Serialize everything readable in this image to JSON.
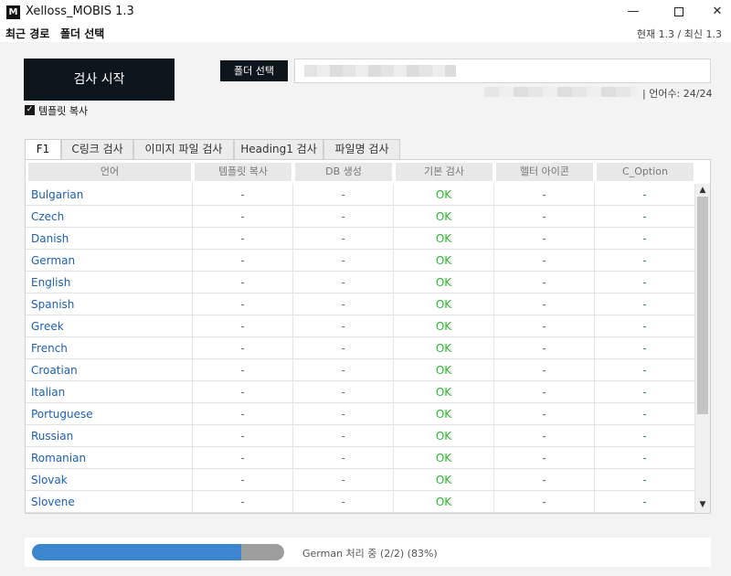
{
  "window": {
    "logo_letter": "M",
    "title": "Xelloss_MOBIS 1.3"
  },
  "menu": {
    "recent": "최근 경로",
    "folder": "폴더 선택",
    "version": "현재 1.3 / 최신 1.3"
  },
  "controls": {
    "start_label": "검사 시작",
    "template_copy_label": "템플릿 복사",
    "template_copy_checked": true,
    "folder_button": "폴더 선택",
    "lang_count": "|  언어수: 24/24"
  },
  "tabs": [
    "F1",
    "C링크 검사",
    "이미지 파일 검사",
    "Heading1 검사",
    "파일명 검사"
  ],
  "table": {
    "headers": [
      "언어",
      "템플릿 복사",
      "DB 생성",
      "기본 검사",
      "헬터 아이콘",
      "C_Option"
    ],
    "rows": [
      [
        "Bulgarian",
        "-",
        "-",
        "OK",
        "-",
        "-"
      ],
      [
        "Czech",
        "-",
        "-",
        "OK",
        "-",
        "-"
      ],
      [
        "Danish",
        "-",
        "-",
        "OK",
        "-",
        "-"
      ],
      [
        "German",
        "-",
        "-",
        "OK",
        "-",
        "-"
      ],
      [
        "English",
        "-",
        "-",
        "OK",
        "-",
        "-"
      ],
      [
        "Spanish",
        "-",
        "-",
        "OK",
        "-",
        "-"
      ],
      [
        "Greek",
        "-",
        "-",
        "OK",
        "-",
        "-"
      ],
      [
        "French",
        "-",
        "-",
        "OK",
        "-",
        "-"
      ],
      [
        "Croatian",
        "-",
        "-",
        "OK",
        "-",
        "-"
      ],
      [
        "Italian",
        "-",
        "-",
        "OK",
        "-",
        "-"
      ],
      [
        "Portuguese",
        "-",
        "-",
        "OK",
        "-",
        "-"
      ],
      [
        "Russian",
        "-",
        "-",
        "OK",
        "-",
        "-"
      ],
      [
        "Romanian",
        "-",
        "-",
        "OK",
        "-",
        "-"
      ],
      [
        "Slovak",
        "-",
        "-",
        "OK",
        "-",
        "-"
      ],
      [
        "Slovene",
        "-",
        "-",
        "OK",
        "-",
        "-"
      ]
    ]
  },
  "status": {
    "progress_percent": 83,
    "text": "German 처리 중 (2/2) (83%)"
  },
  "colors": {
    "dark_button": "#0e161d",
    "language_link": "#1a5fb4",
    "ok_green": "#29b82d",
    "progress_blue": "#3b86cf"
  }
}
